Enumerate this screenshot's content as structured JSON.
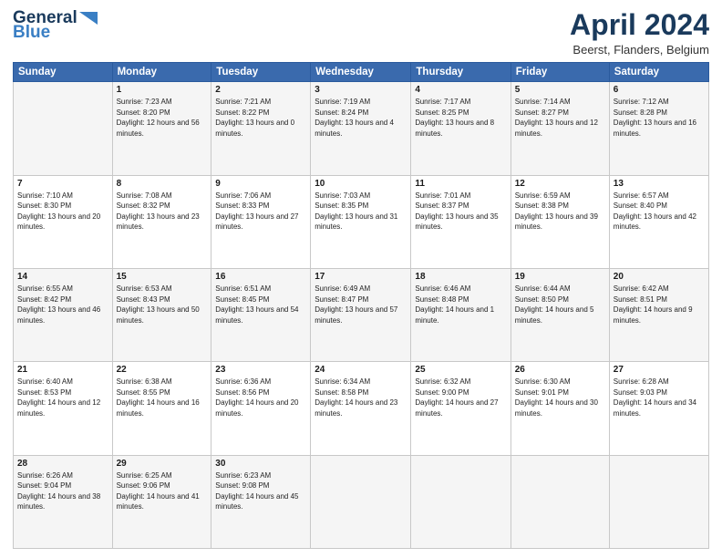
{
  "header": {
    "logo_line1": "General",
    "logo_line2": "Blue",
    "main_title": "April 2024",
    "subtitle": "Beerst, Flanders, Belgium"
  },
  "columns": [
    "Sunday",
    "Monday",
    "Tuesday",
    "Wednesday",
    "Thursday",
    "Friday",
    "Saturday"
  ],
  "weeks": [
    [
      {
        "day": "",
        "sunrise": "",
        "sunset": "",
        "daylight": ""
      },
      {
        "day": "1",
        "sunrise": "Sunrise: 7:23 AM",
        "sunset": "Sunset: 8:20 PM",
        "daylight": "Daylight: 12 hours and 56 minutes."
      },
      {
        "day": "2",
        "sunrise": "Sunrise: 7:21 AM",
        "sunset": "Sunset: 8:22 PM",
        "daylight": "Daylight: 13 hours and 0 minutes."
      },
      {
        "day": "3",
        "sunrise": "Sunrise: 7:19 AM",
        "sunset": "Sunset: 8:24 PM",
        "daylight": "Daylight: 13 hours and 4 minutes."
      },
      {
        "day": "4",
        "sunrise": "Sunrise: 7:17 AM",
        "sunset": "Sunset: 8:25 PM",
        "daylight": "Daylight: 13 hours and 8 minutes."
      },
      {
        "day": "5",
        "sunrise": "Sunrise: 7:14 AM",
        "sunset": "Sunset: 8:27 PM",
        "daylight": "Daylight: 13 hours and 12 minutes."
      },
      {
        "day": "6",
        "sunrise": "Sunrise: 7:12 AM",
        "sunset": "Sunset: 8:28 PM",
        "daylight": "Daylight: 13 hours and 16 minutes."
      }
    ],
    [
      {
        "day": "7",
        "sunrise": "Sunrise: 7:10 AM",
        "sunset": "Sunset: 8:30 PM",
        "daylight": "Daylight: 13 hours and 20 minutes."
      },
      {
        "day": "8",
        "sunrise": "Sunrise: 7:08 AM",
        "sunset": "Sunset: 8:32 PM",
        "daylight": "Daylight: 13 hours and 23 minutes."
      },
      {
        "day": "9",
        "sunrise": "Sunrise: 7:06 AM",
        "sunset": "Sunset: 8:33 PM",
        "daylight": "Daylight: 13 hours and 27 minutes."
      },
      {
        "day": "10",
        "sunrise": "Sunrise: 7:03 AM",
        "sunset": "Sunset: 8:35 PM",
        "daylight": "Daylight: 13 hours and 31 minutes."
      },
      {
        "day": "11",
        "sunrise": "Sunrise: 7:01 AM",
        "sunset": "Sunset: 8:37 PM",
        "daylight": "Daylight: 13 hours and 35 minutes."
      },
      {
        "day": "12",
        "sunrise": "Sunrise: 6:59 AM",
        "sunset": "Sunset: 8:38 PM",
        "daylight": "Daylight: 13 hours and 39 minutes."
      },
      {
        "day": "13",
        "sunrise": "Sunrise: 6:57 AM",
        "sunset": "Sunset: 8:40 PM",
        "daylight": "Daylight: 13 hours and 42 minutes."
      }
    ],
    [
      {
        "day": "14",
        "sunrise": "Sunrise: 6:55 AM",
        "sunset": "Sunset: 8:42 PM",
        "daylight": "Daylight: 13 hours and 46 minutes."
      },
      {
        "day": "15",
        "sunrise": "Sunrise: 6:53 AM",
        "sunset": "Sunset: 8:43 PM",
        "daylight": "Daylight: 13 hours and 50 minutes."
      },
      {
        "day": "16",
        "sunrise": "Sunrise: 6:51 AM",
        "sunset": "Sunset: 8:45 PM",
        "daylight": "Daylight: 13 hours and 54 minutes."
      },
      {
        "day": "17",
        "sunrise": "Sunrise: 6:49 AM",
        "sunset": "Sunset: 8:47 PM",
        "daylight": "Daylight: 13 hours and 57 minutes."
      },
      {
        "day": "18",
        "sunrise": "Sunrise: 6:46 AM",
        "sunset": "Sunset: 8:48 PM",
        "daylight": "Daylight: 14 hours and 1 minute."
      },
      {
        "day": "19",
        "sunrise": "Sunrise: 6:44 AM",
        "sunset": "Sunset: 8:50 PM",
        "daylight": "Daylight: 14 hours and 5 minutes."
      },
      {
        "day": "20",
        "sunrise": "Sunrise: 6:42 AM",
        "sunset": "Sunset: 8:51 PM",
        "daylight": "Daylight: 14 hours and 9 minutes."
      }
    ],
    [
      {
        "day": "21",
        "sunrise": "Sunrise: 6:40 AM",
        "sunset": "Sunset: 8:53 PM",
        "daylight": "Daylight: 14 hours and 12 minutes."
      },
      {
        "day": "22",
        "sunrise": "Sunrise: 6:38 AM",
        "sunset": "Sunset: 8:55 PM",
        "daylight": "Daylight: 14 hours and 16 minutes."
      },
      {
        "day": "23",
        "sunrise": "Sunrise: 6:36 AM",
        "sunset": "Sunset: 8:56 PM",
        "daylight": "Daylight: 14 hours and 20 minutes."
      },
      {
        "day": "24",
        "sunrise": "Sunrise: 6:34 AM",
        "sunset": "Sunset: 8:58 PM",
        "daylight": "Daylight: 14 hours and 23 minutes."
      },
      {
        "day": "25",
        "sunrise": "Sunrise: 6:32 AM",
        "sunset": "Sunset: 9:00 PM",
        "daylight": "Daylight: 14 hours and 27 minutes."
      },
      {
        "day": "26",
        "sunrise": "Sunrise: 6:30 AM",
        "sunset": "Sunset: 9:01 PM",
        "daylight": "Daylight: 14 hours and 30 minutes."
      },
      {
        "day": "27",
        "sunrise": "Sunrise: 6:28 AM",
        "sunset": "Sunset: 9:03 PM",
        "daylight": "Daylight: 14 hours and 34 minutes."
      }
    ],
    [
      {
        "day": "28",
        "sunrise": "Sunrise: 6:26 AM",
        "sunset": "Sunset: 9:04 PM",
        "daylight": "Daylight: 14 hours and 38 minutes."
      },
      {
        "day": "29",
        "sunrise": "Sunrise: 6:25 AM",
        "sunset": "Sunset: 9:06 PM",
        "daylight": "Daylight: 14 hours and 41 minutes."
      },
      {
        "day": "30",
        "sunrise": "Sunrise: 6:23 AM",
        "sunset": "Sunset: 9:08 PM",
        "daylight": "Daylight: 14 hours and 45 minutes."
      },
      {
        "day": "",
        "sunrise": "",
        "sunset": "",
        "daylight": ""
      },
      {
        "day": "",
        "sunrise": "",
        "sunset": "",
        "daylight": ""
      },
      {
        "day": "",
        "sunrise": "",
        "sunset": "",
        "daylight": ""
      },
      {
        "day": "",
        "sunrise": "",
        "sunset": "",
        "daylight": ""
      }
    ]
  ]
}
